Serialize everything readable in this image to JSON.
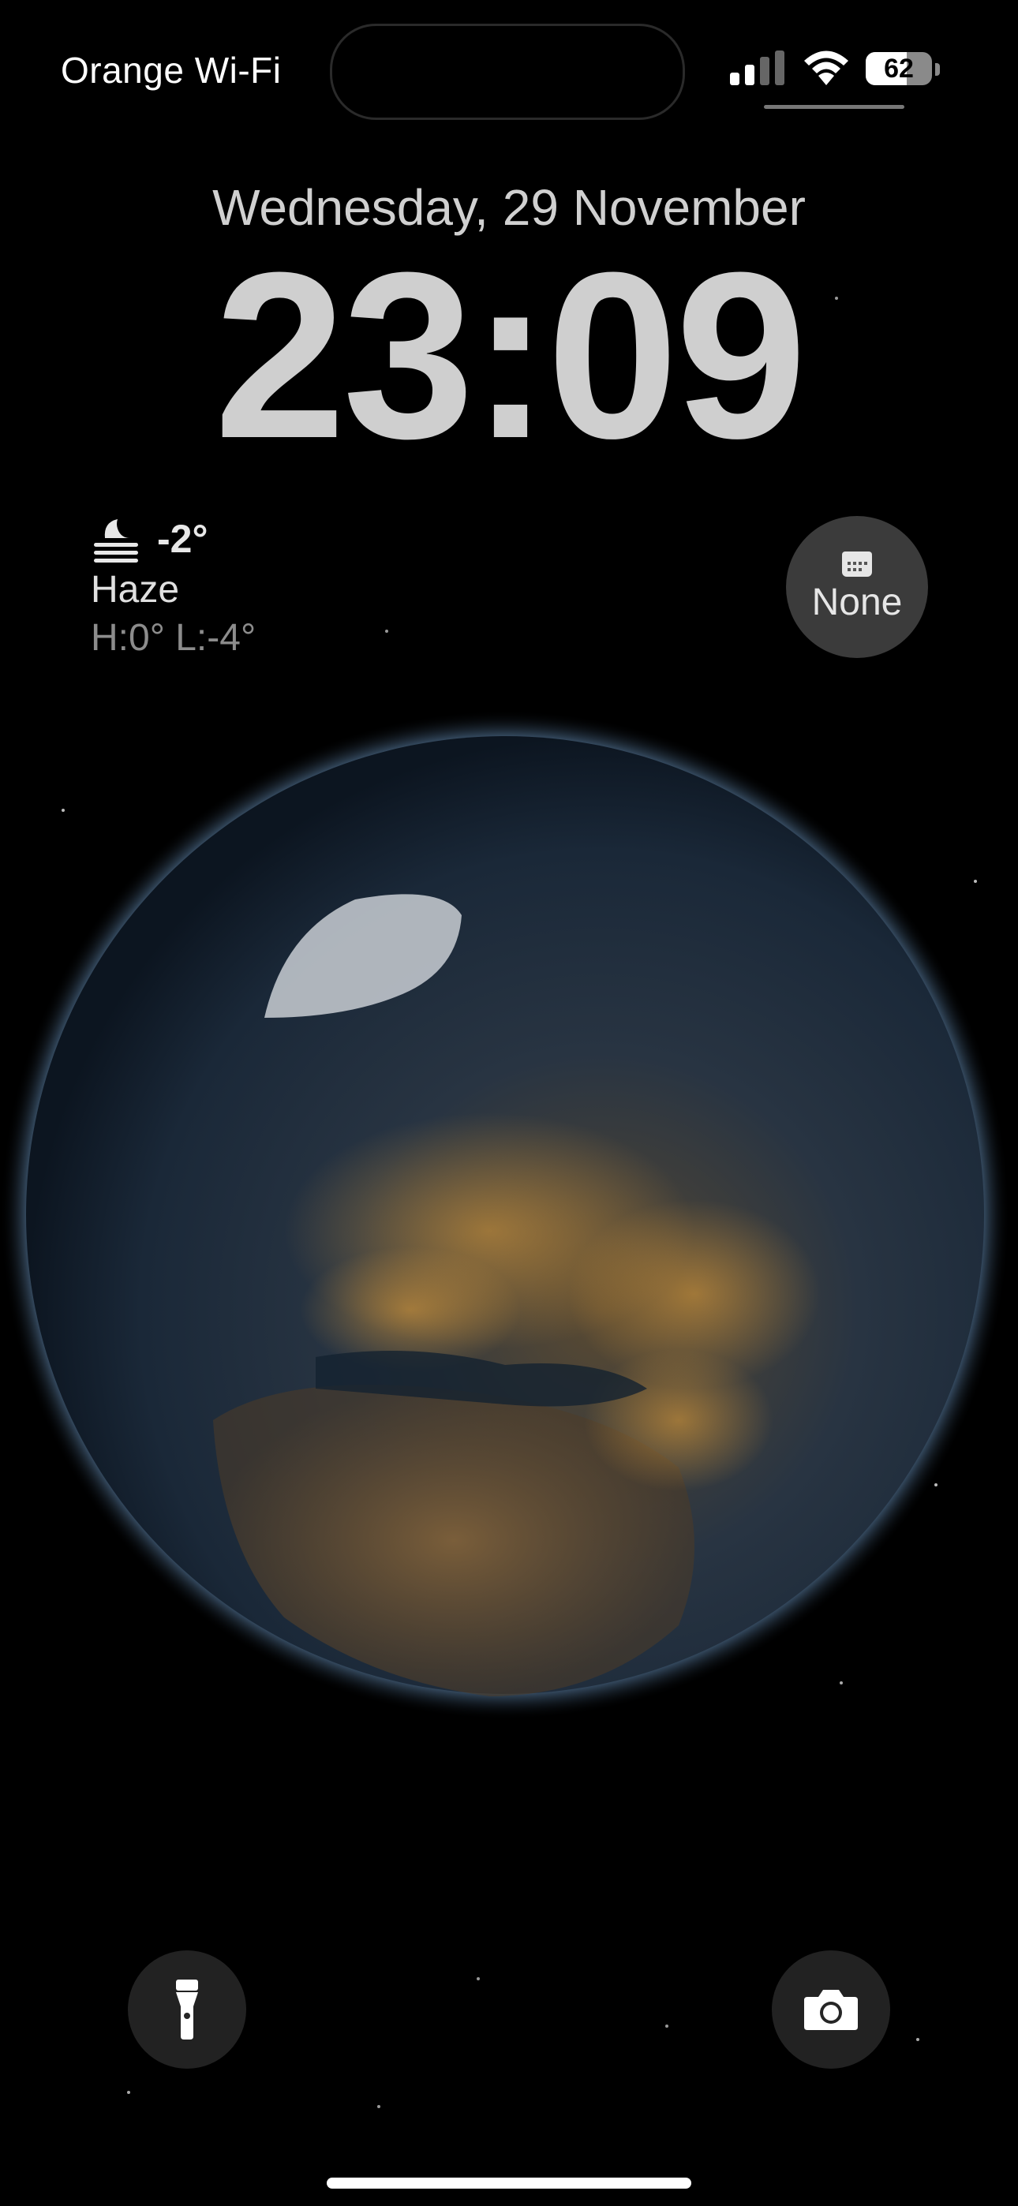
{
  "status_bar": {
    "carrier": "Orange Wi-Fi",
    "signal_bars": 4,
    "signal_bars_active": 2,
    "wifi_icon": "wifi-icon",
    "battery_percent": 62
  },
  "lock_screen": {
    "date": "Wednesday, 29 November",
    "time": "23:09"
  },
  "weather_widget": {
    "icon": "haze-moon-icon",
    "temperature": "-2°",
    "condition": "Haze",
    "high_low": "H:0° L:-4°"
  },
  "calendar_widget": {
    "icon": "calendar-icon",
    "label": "None"
  },
  "quick_actions": {
    "flashlight_icon": "flashlight-icon",
    "camera_icon": "camera-icon"
  },
  "colors": {
    "background": "#000000",
    "text_primary": "#ffffff",
    "clock": "#cfcfcf",
    "city_lights": "#e8a33a",
    "atmosphere": "#7fb2e6"
  }
}
